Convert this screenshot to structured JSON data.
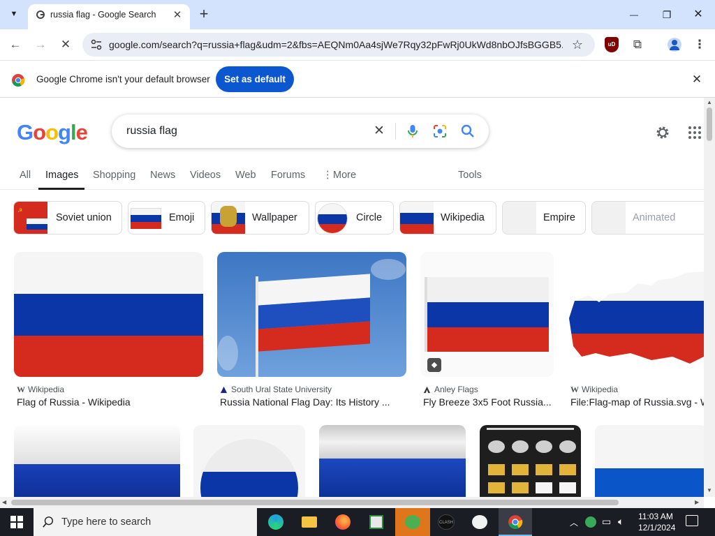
{
  "browser": {
    "tab_title": "russia flag - Google Search",
    "tab_close": "✕",
    "new_tab": "+",
    "url": "google.com/search?q=russia+flag&udm=2&fbs=AEQNm0Aa4sjWe7Rqy32pFwRj0UkWd8nbOJfsBGGB5...",
    "window_controls": {
      "minimize": "—",
      "maximize": "❐",
      "close": "✕"
    }
  },
  "infobar": {
    "message": "Google Chrome isn't your default browser",
    "button_label": "Set as default",
    "close": "✕"
  },
  "search": {
    "logo": "Google",
    "query": "russia flag",
    "clear": "✕"
  },
  "nav_tabs": [
    {
      "label": "All"
    },
    {
      "label": "Images"
    },
    {
      "label": "Shopping"
    },
    {
      "label": "News"
    },
    {
      "label": "Videos"
    },
    {
      "label": "Web"
    },
    {
      "label": "Forums"
    },
    {
      "label": "More"
    }
  ],
  "tools_label": "Tools",
  "chips": [
    {
      "label": "Soviet union"
    },
    {
      "label": "Emoji"
    },
    {
      "label": "Wallpaper"
    },
    {
      "label": "Circle"
    },
    {
      "label": "Wikipedia"
    },
    {
      "label": "Empire"
    },
    {
      "label": "Animated"
    }
  ],
  "results": [
    {
      "source": "Wikipedia",
      "title": "Flag of Russia - Wikipedia"
    },
    {
      "source": "South Ural State University",
      "title": "Russia National Flag Day: Its History ..."
    },
    {
      "source": "Anley Flags",
      "title": "Fly Breeze 3x5 Foot Russia..."
    },
    {
      "source": "Wikipedia",
      "title": "File:Flag-map of Russia.svg - Wikipedia"
    }
  ],
  "taskbar": {
    "search_placeholder": "Type here to search",
    "time": "11:03 AM",
    "date": "12/1/2024"
  },
  "colors": {
    "russia_white": "#f5f5f5",
    "russia_blue": "#0a36a8",
    "russia_red": "#d52b1e",
    "google_blue": "#4285f4",
    "google_red": "#ea4335",
    "google_yellow": "#fbbc05",
    "google_green": "#34a853",
    "accent": "#0b57d0"
  }
}
